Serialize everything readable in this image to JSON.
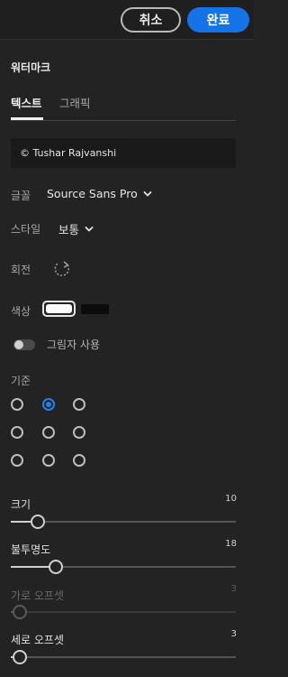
{
  "header": {
    "cancel_label": "취소",
    "done_label": "완료"
  },
  "panel_title": "워터마크",
  "tabs": [
    {
      "label": "텍스트",
      "active": true
    },
    {
      "label": "그래픽",
      "active": false
    }
  ],
  "text_field": {
    "value": "© Tushar Rajvanshi"
  },
  "font": {
    "label": "글꼴",
    "value": "Source Sans Pro"
  },
  "style": {
    "label": "스타일",
    "value": "보통"
  },
  "rotation": {
    "label": "회전",
    "icon": "rotate-icon"
  },
  "color": {
    "label": "색상",
    "selected": "#FFFFFF",
    "alternate": "#000000"
  },
  "shadow": {
    "label": "그림자 사용",
    "enabled": false
  },
  "anchor": {
    "label": "기준",
    "selected_row": 0,
    "selected_col": 1
  },
  "sliders": {
    "size": {
      "label": "크기",
      "value": "10",
      "fraction": 0.12,
      "enabled": true
    },
    "opacity": {
      "label": "불투명도",
      "value": "18",
      "fraction": 0.2,
      "enabled": true
    },
    "horizontal_offset": {
      "label": "가로 오프셋",
      "value": "3",
      "fraction": 0.04,
      "enabled": false
    },
    "vertical_offset": {
      "label": "세로 오프셋",
      "value": "3",
      "fraction": 0.04,
      "enabled": true
    }
  },
  "colors": {
    "accent": "#1473e6",
    "radio_selected": "#2680eb",
    "background": "#232323"
  }
}
